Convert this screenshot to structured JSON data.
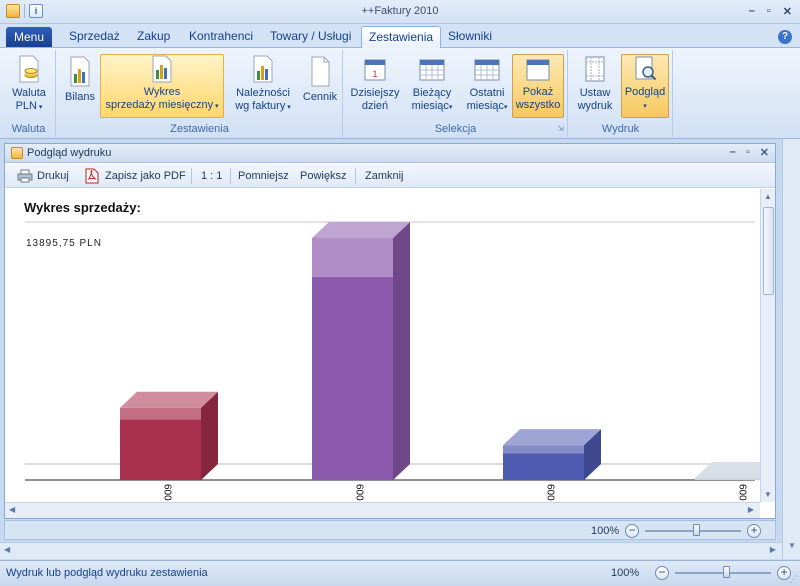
{
  "app": {
    "title": "++Faktury 2010"
  },
  "tabs": {
    "menu": "Menu",
    "items": [
      "Sprzedaż",
      "Zakup",
      "Kontrahenci",
      "Towary / Usługi",
      "Zestawienia",
      "Słowniki"
    ],
    "active": "Zestawienia"
  },
  "ribbon": {
    "waluta": {
      "button": "Waluta\nPLN",
      "group": "Waluta"
    },
    "zestawienia": {
      "bilans": "Bilans",
      "wykres": "Wykres\nsprzedaży miesięczny",
      "naleznosci": "Należności\nwg faktury",
      "cennik": "Cennik",
      "group": "Zestawienia"
    },
    "selekcja": {
      "dzisiejszy": "Dzisiejszy\ndzień",
      "biezacy": "Bieżący\nmiesiąc",
      "ostatni": "Ostatni\nmiesiąc",
      "pokaz": "Pokaż\nwszystko",
      "group": "Selekcja"
    },
    "wydruk": {
      "ustaw": "Ustaw\nwydruk",
      "podglad": "Podgląd",
      "group": "Wydruk"
    }
  },
  "preview": {
    "title": "Podgląd wydruku",
    "toolbar": {
      "print": "Drukuj",
      "pdf": "Zapisz jako PDF",
      "ratio": "1 : 1",
      "zoom_out": "Pomniejsz",
      "zoom_in": "Powiększ",
      "close": "Zamknij"
    },
    "zoom": "100%"
  },
  "chart_data": {
    "type": "bar",
    "title": "Wykres sprzedaży:",
    "top_label": "13895,75 PLN",
    "categories": [
      "600",
      "600",
      "600",
      "600"
    ],
    "values": [
      4150,
      13895.75,
      2000,
      80
    ],
    "ylim": [
      0,
      13895.75
    ],
    "colors": [
      "#a8304e",
      "#8c5aad",
      "#4f5bb0",
      "#b8c4d4"
    ]
  },
  "status": {
    "text": "Wydruk lub podgląd wydruku zestawienia",
    "zoom": "100%"
  }
}
